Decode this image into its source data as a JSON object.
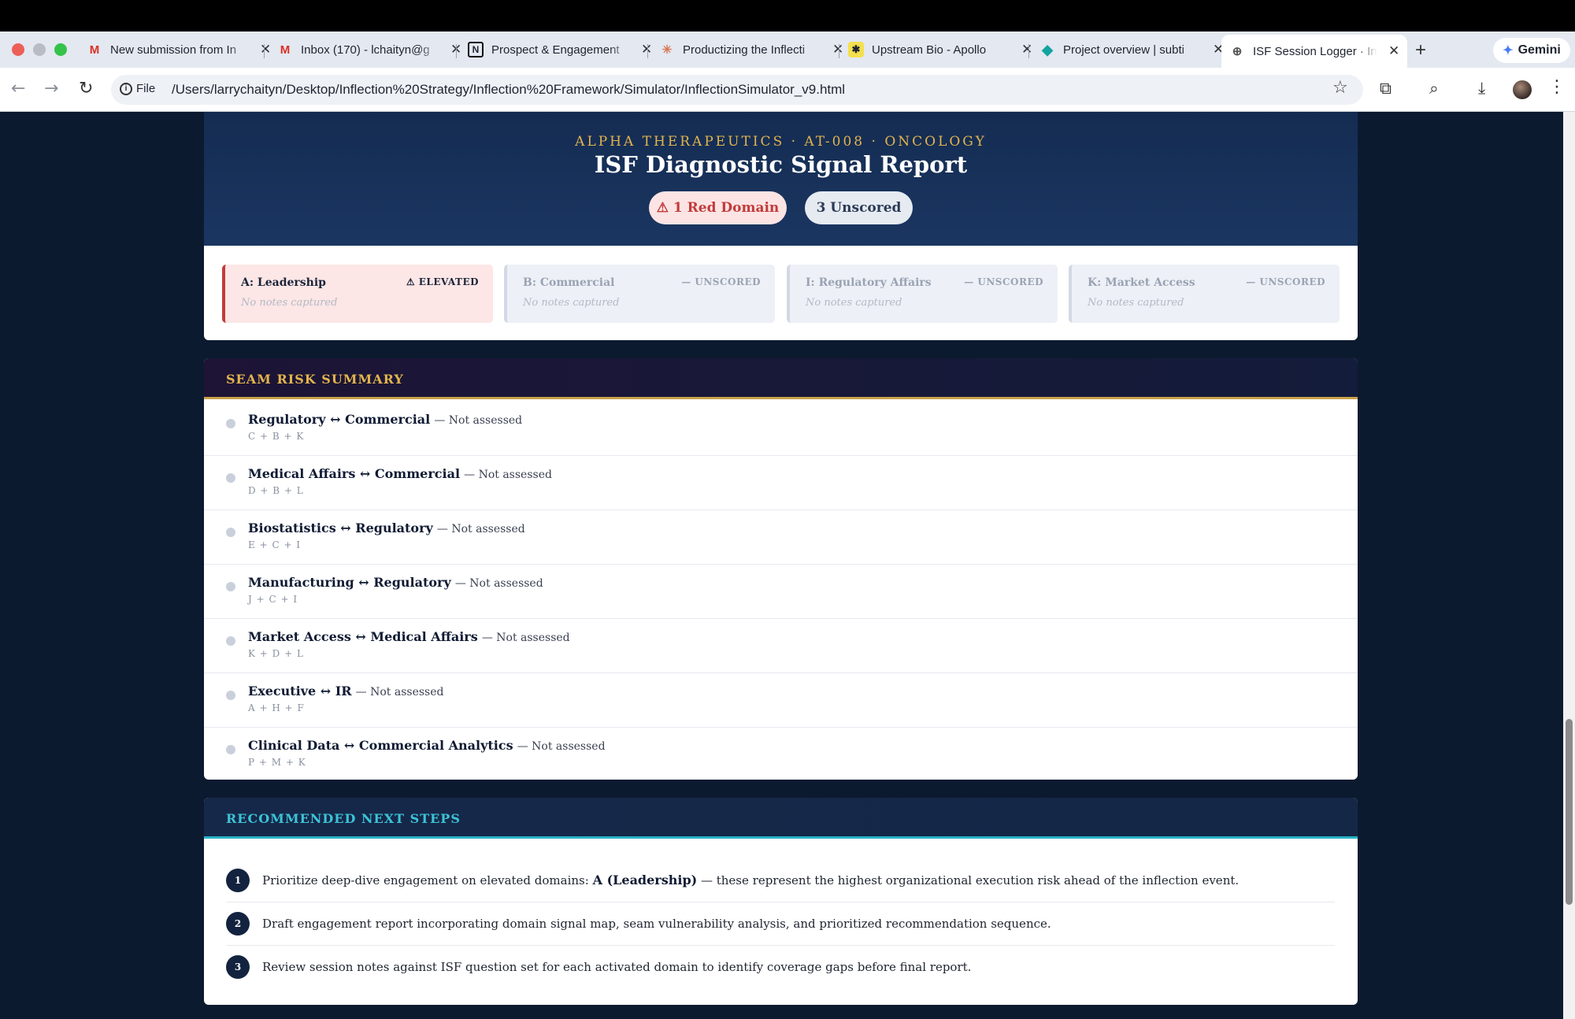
{
  "browser": {
    "tabs": [
      {
        "title": "New submission from In",
        "icon": "gmail-icon"
      },
      {
        "title": "Inbox (170) - lchaityn@g",
        "icon": "gmail-icon"
      },
      {
        "title": "Prospect & Engagement",
        "icon": "notion-icon"
      },
      {
        "title": "Productizing the Inflecti",
        "icon": "claude-icon"
      },
      {
        "title": "Upstream Bio - Apollo",
        "icon": "apollo-icon"
      },
      {
        "title": "Project overview | subti",
        "icon": "diamond-icon"
      },
      {
        "title": "ISF Session Logger · Inf",
        "icon": "globe-icon",
        "active": true
      }
    ],
    "new_tab": "+",
    "gemini_label": "Gemini",
    "file_label": "File",
    "url": "/Users/larrychaityn/Desktop/Inflection%20Strategy/Inflection%20Framework/Simulator/InflectionSimulator_v9.html"
  },
  "report": {
    "company_line": "ALPHA THERAPEUTICS · AT-008 · ONCOLOGY",
    "title": "ISF Diagnostic Signal Report",
    "badge_red": "⚠ 1 Red Domain",
    "badge_unscored": "3 Unscored",
    "colors": {
      "navy": "#152c52",
      "gold": "#e3b54c",
      "red": "#c23b3b",
      "teal": "#27b3c6"
    }
  },
  "domains": [
    {
      "name": "A: Leadership",
      "status": "⚠ ELEVATED",
      "note": "No notes captured",
      "state": "elevated"
    },
    {
      "name": "B: Commercial",
      "status": "— UNSCORED",
      "note": "No notes captured",
      "state": "unscored"
    },
    {
      "name": "I: Regulatory Affairs",
      "status": "— UNSCORED",
      "note": "No notes captured",
      "state": "unscored"
    },
    {
      "name": "K: Market Access",
      "status": "— UNSCORED",
      "note": "No notes captured",
      "state": "unscored"
    }
  ],
  "seam": {
    "heading": "SEAM RISK SUMMARY",
    "rows": [
      {
        "name": "Regulatory ↔ Commercial",
        "status": "— Not assessed",
        "codes": "C + B + K"
      },
      {
        "name": "Medical Affairs ↔ Commercial",
        "status": "— Not assessed",
        "codes": "D + B + L"
      },
      {
        "name": "Biostatistics ↔ Regulatory",
        "status": "— Not assessed",
        "codes": "E + C + I"
      },
      {
        "name": "Manufacturing ↔ Regulatory",
        "status": "— Not assessed",
        "codes": "J + C + I"
      },
      {
        "name": "Market Access ↔ Medical Affairs",
        "status": "— Not assessed",
        "codes": "K + D + L"
      },
      {
        "name": "Executive ↔ IR",
        "status": "— Not assessed",
        "codes": "A + H + F"
      },
      {
        "name": "Clinical Data ↔ Commercial Analytics",
        "status": "— Not assessed",
        "codes": "P + M + K"
      }
    ]
  },
  "steps": {
    "heading": "RECOMMENDED NEXT STEPS",
    "items": [
      {
        "num": "1",
        "pre": "Prioritize deep-dive engagement on elevated domains: ",
        "bold": "A (Leadership)",
        "post": " — these represent the highest organizational execution risk ahead of the inflection event."
      },
      {
        "num": "2",
        "pre": "Draft engagement report incorporating domain signal map, seam vulnerability analysis, and prioritized recommendation sequence.",
        "bold": "",
        "post": ""
      },
      {
        "num": "3",
        "pre": "Review session notes against ISF question set for each activated domain to identify coverage gaps before final report.",
        "bold": "",
        "post": ""
      }
    ]
  }
}
